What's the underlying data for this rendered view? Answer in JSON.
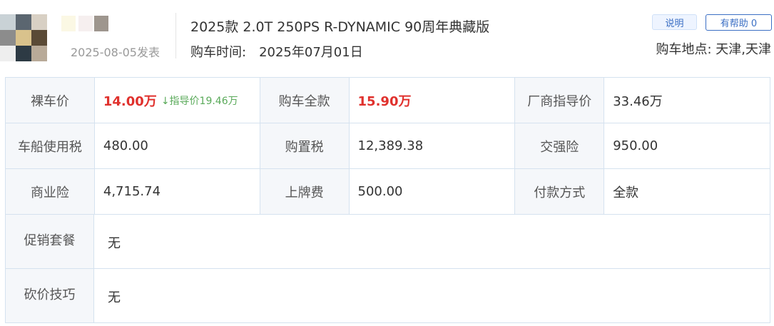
{
  "header": {
    "post_date": "2025-08-05发表",
    "car_model": "2025款 2.0T 250PS R-DYNAMIC 90周年典藏版",
    "buy_time_label": "购车时间:",
    "buy_time_value": "2025年07月01日",
    "explain_button": "说明",
    "helpful_button": "有帮助 0",
    "buy_place": "购车地点: 天津,天津"
  },
  "price_table": {
    "rows": [
      [
        {
          "label": "裸车价",
          "value": "14.00万",
          "note": "↓指导价19.46万"
        },
        {
          "label": "购车全款",
          "value": "15.90万"
        },
        {
          "label": "厂商指导价",
          "value": "33.46万"
        }
      ],
      [
        {
          "label": "车船使用税",
          "value": "480.00"
        },
        {
          "label": "购置税",
          "value": "12,389.38"
        },
        {
          "label": "交强险",
          "value": "950.00"
        }
      ],
      [
        {
          "label": "商业险",
          "value": "4,715.74"
        },
        {
          "label": "上牌费",
          "value": "500.00"
        },
        {
          "label": "付款方式",
          "value": "全款"
        }
      ]
    ],
    "promotion": {
      "label": "促销套餐",
      "value": "无"
    },
    "bargain": {
      "label": "砍价技巧",
      "value": "无"
    }
  },
  "colors": {
    "accent_red": "#e0312d",
    "accent_green": "#5aaa5a",
    "link_blue": "#3b6fc4",
    "border": "#d5e2ef",
    "label_bg": "#f5f7fa"
  }
}
